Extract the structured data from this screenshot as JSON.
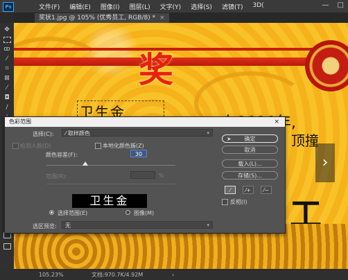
{
  "app": {
    "logo": "Ps",
    "menu": [
      "文件(F)",
      "编辑(E)",
      "图像(I)",
      "图层(L)",
      "文字(Y)",
      "选择(S)",
      "滤镜(T)",
      "3D("
    ],
    "window_controls": [
      "—",
      "□"
    ]
  },
  "document": {
    "tab_label": "奖状1.jpg @ 105% (优秀员工, RGB/8) *",
    "tab_close": "×"
  },
  "canvas": {
    "title": "奖",
    "name_text": "卫生金",
    "line1": "在2020年,",
    "line2": "顶撞",
    "line3": "工"
  },
  "toolbar": {
    "icons": [
      "move-icon",
      "marquee-icon",
      "lasso-icon",
      "quick-select-icon",
      "crop-icon",
      "frame-icon",
      "eyedropper-icon",
      "healing-icon",
      "brush-icon",
      "stamp-icon",
      "history-brush-icon",
      "eraser-icon"
    ]
  },
  "nav": {
    "arrow": "›"
  },
  "status": {
    "zoom": "105.23%",
    "doc": "文档:970.7K/4.92M",
    "arrow": "›"
  },
  "dialog": {
    "title": "色彩范围",
    "close": "×",
    "select_label": "选择(C):",
    "select_value": "取样颜色",
    "detect_faces_label": "检测人脸(D)",
    "localized_label": "本地化颜色簇(Z)",
    "fuzziness_label": "颜色容差(F):",
    "fuzziness_value": "30",
    "range_label": "范围(R):",
    "range_unit": "%",
    "preview_text": "卫生金",
    "radio_selection": "选择范围(E)",
    "radio_image": "图像(M)",
    "selection_preview_label": "选区预览:",
    "selection_preview_value": "无",
    "ok": "确定",
    "cancel": "取消",
    "load": "载入(L)...",
    "save": "存储(S)...",
    "invert": "反相(I)",
    "fuzziness_fraction": 0.3
  }
}
